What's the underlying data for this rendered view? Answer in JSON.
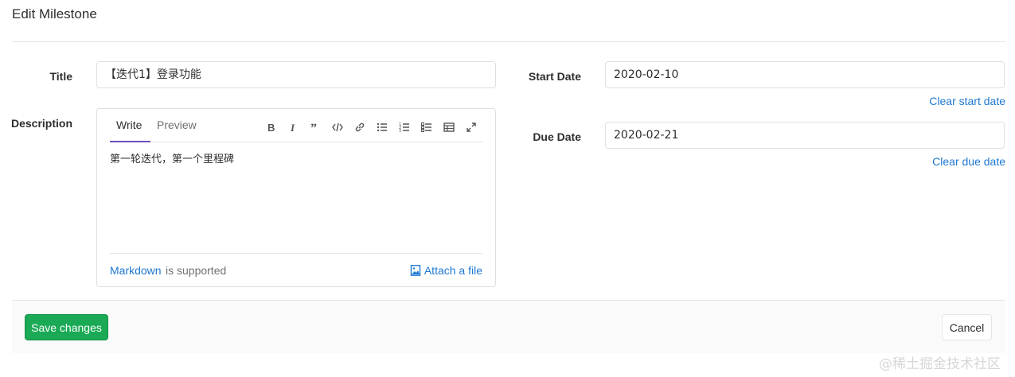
{
  "page": {
    "title": "Edit Milestone"
  },
  "form": {
    "title_label": "Title",
    "title_value": "【迭代1】登录功能",
    "description_label": "Description",
    "start_date_label": "Start Date",
    "start_date_value": "2020-02-10",
    "clear_start_date": "Clear start date",
    "due_date_label": "Due Date",
    "due_date_value": "2020-02-21",
    "clear_due_date": "Clear due date"
  },
  "editor": {
    "tabs": {
      "write": "Write",
      "preview": "Preview"
    },
    "toolbar": [
      "bold-icon",
      "italic-icon",
      "quote-icon",
      "code-icon",
      "link-icon",
      "bulleted-list-icon",
      "numbered-list-icon",
      "task-list-icon",
      "table-icon",
      "fullscreen-icon"
    ],
    "content": "第一轮迭代，第一个里程碑",
    "markdown_link": "Markdown",
    "supported_text": "is supported",
    "attach_label": "Attach a file"
  },
  "actions": {
    "save": "Save changes",
    "cancel": "Cancel"
  },
  "watermark": "@稀土掘金技术社区",
  "colors": {
    "accent": "#1aaa55",
    "link": "#1f78d1",
    "tab_underline": "#6b4fbb"
  }
}
